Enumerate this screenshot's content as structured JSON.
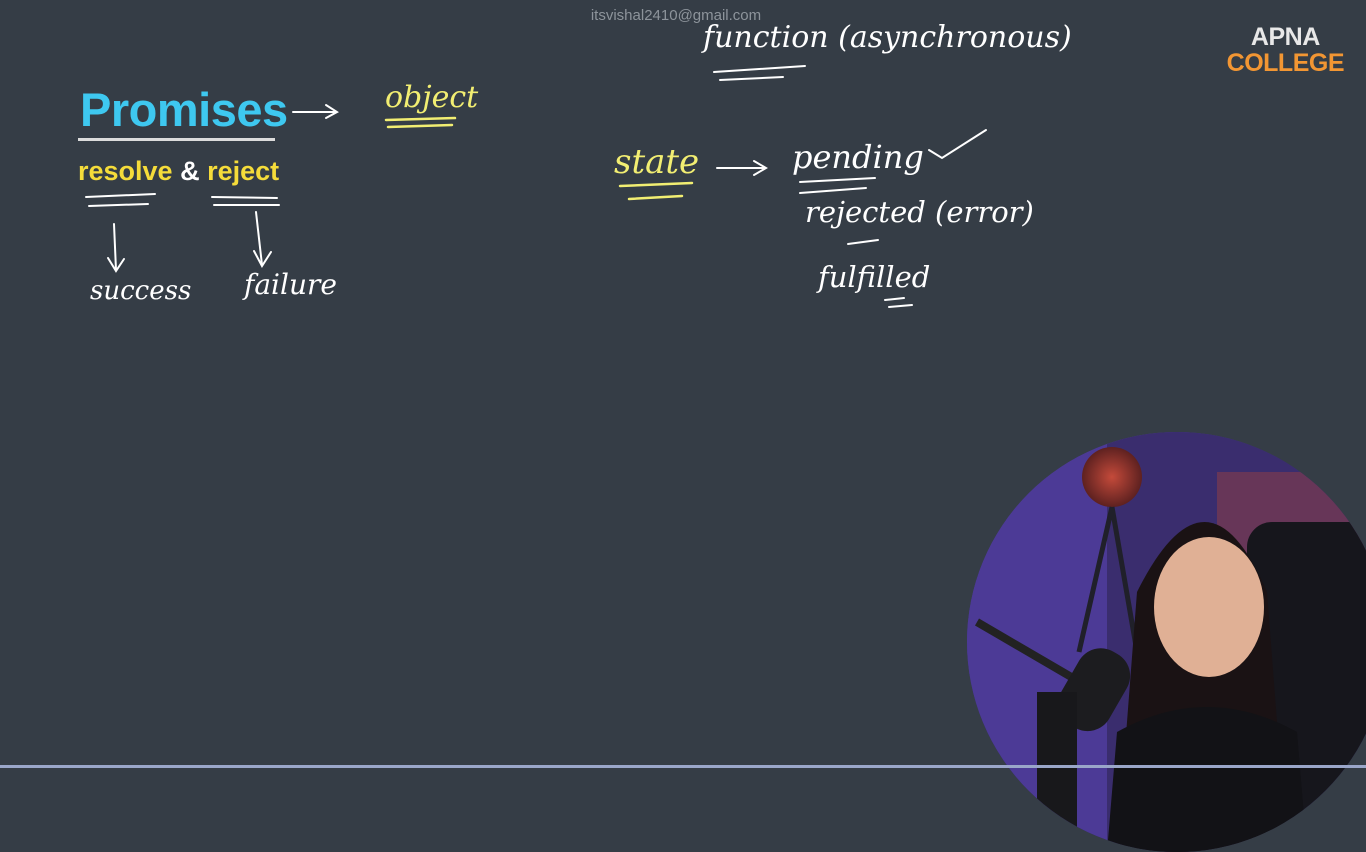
{
  "watermark": "itsvishal2410@gmail.com",
  "logo": {
    "line1": "APNA",
    "line2": "COLLEGE"
  },
  "title": "Promises",
  "subtitle": {
    "resolve": "resolve",
    "amp": " & ",
    "reject": "reject"
  },
  "notes": {
    "object": "object",
    "success": "success",
    "failure": "failure",
    "function_line": "function (asynchronous)",
    "state": "state",
    "pending": "pending",
    "rejected": "rejected (error)",
    "fulfilled": "fulfilled"
  },
  "colors": {
    "background": "#353d46",
    "title": "#3ec8f0",
    "highlight_yellow": "#f5dc3a",
    "logo_orange": "#f29633"
  }
}
